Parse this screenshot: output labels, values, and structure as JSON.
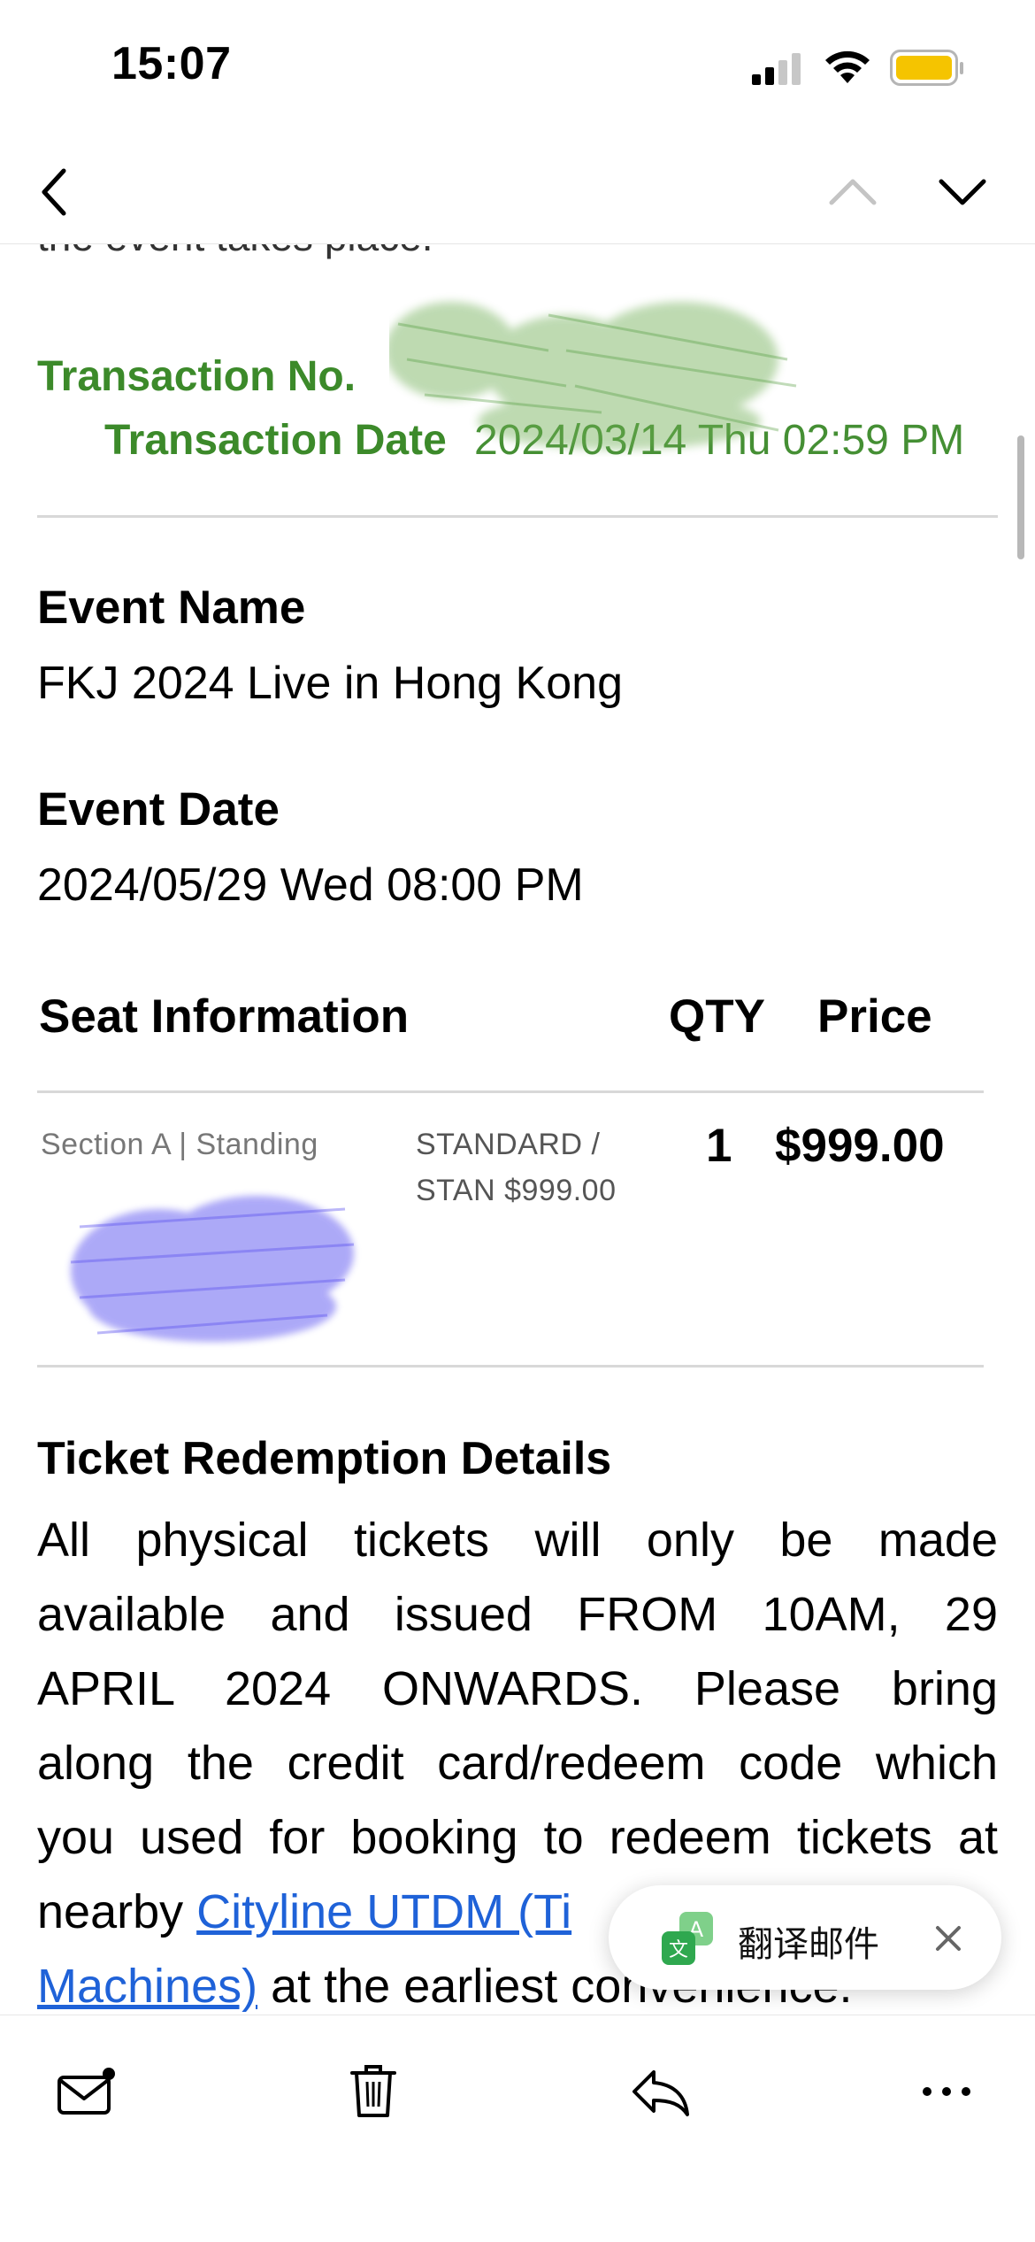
{
  "status_bar": {
    "time": "15:07"
  },
  "nav": {
    "back_icon": "chevron-left-icon",
    "prev_icon": "chevron-up-icon",
    "next_icon": "chevron-down-icon"
  },
  "email": {
    "faded_text": "the event takes place.",
    "transaction_no_label": "Transaction No.",
    "transaction_date_label": "Transaction Date",
    "transaction_date_value": "2024/03/14 Thu 02:59 PM",
    "event_name_label": "Event Name",
    "event_name_value": "FKJ 2024 Live in Hong Kong",
    "event_date_label": "Event Date",
    "event_date_value": "2024/05/29 Wed 08:00 PM",
    "seat_table": {
      "headers": {
        "seat": "Seat Information",
        "qty": "QTY",
        "price": "Price"
      },
      "row": {
        "section": "Section A | Standing",
        "ticket_type_line1": "STANDARD /",
        "ticket_type_line2": "STAN $999.00",
        "qty": "1",
        "price": "$999.00"
      }
    },
    "redemption": {
      "title": "Ticket Redemption Details",
      "line1": "All physical tickets will only be made",
      "line2": "available and issued FROM 10AM, 29",
      "line3": "APRIL 2024 ONWARDS. Please bring",
      "line4": "along the credit card/redeem code which",
      "line5": "you used for booking to redeem tickets at",
      "line6_prefix": "nearby",
      "link_part1": "Cityline UTDM (Ti",
      "link_part2": "Machines)",
      "line7_suffix": "at the earliest convenience."
    }
  },
  "translate_popup": {
    "label": "翻译邮件",
    "icon": "translate-icon",
    "close_icon": "close-icon"
  },
  "toolbar": {
    "items": [
      "mail-unread-icon",
      "trash-icon",
      "reply-icon",
      "more-icon"
    ]
  },
  "colors": {
    "green": "#3c8a2a",
    "link": "#1f62d8",
    "battery": "#f5c400"
  }
}
